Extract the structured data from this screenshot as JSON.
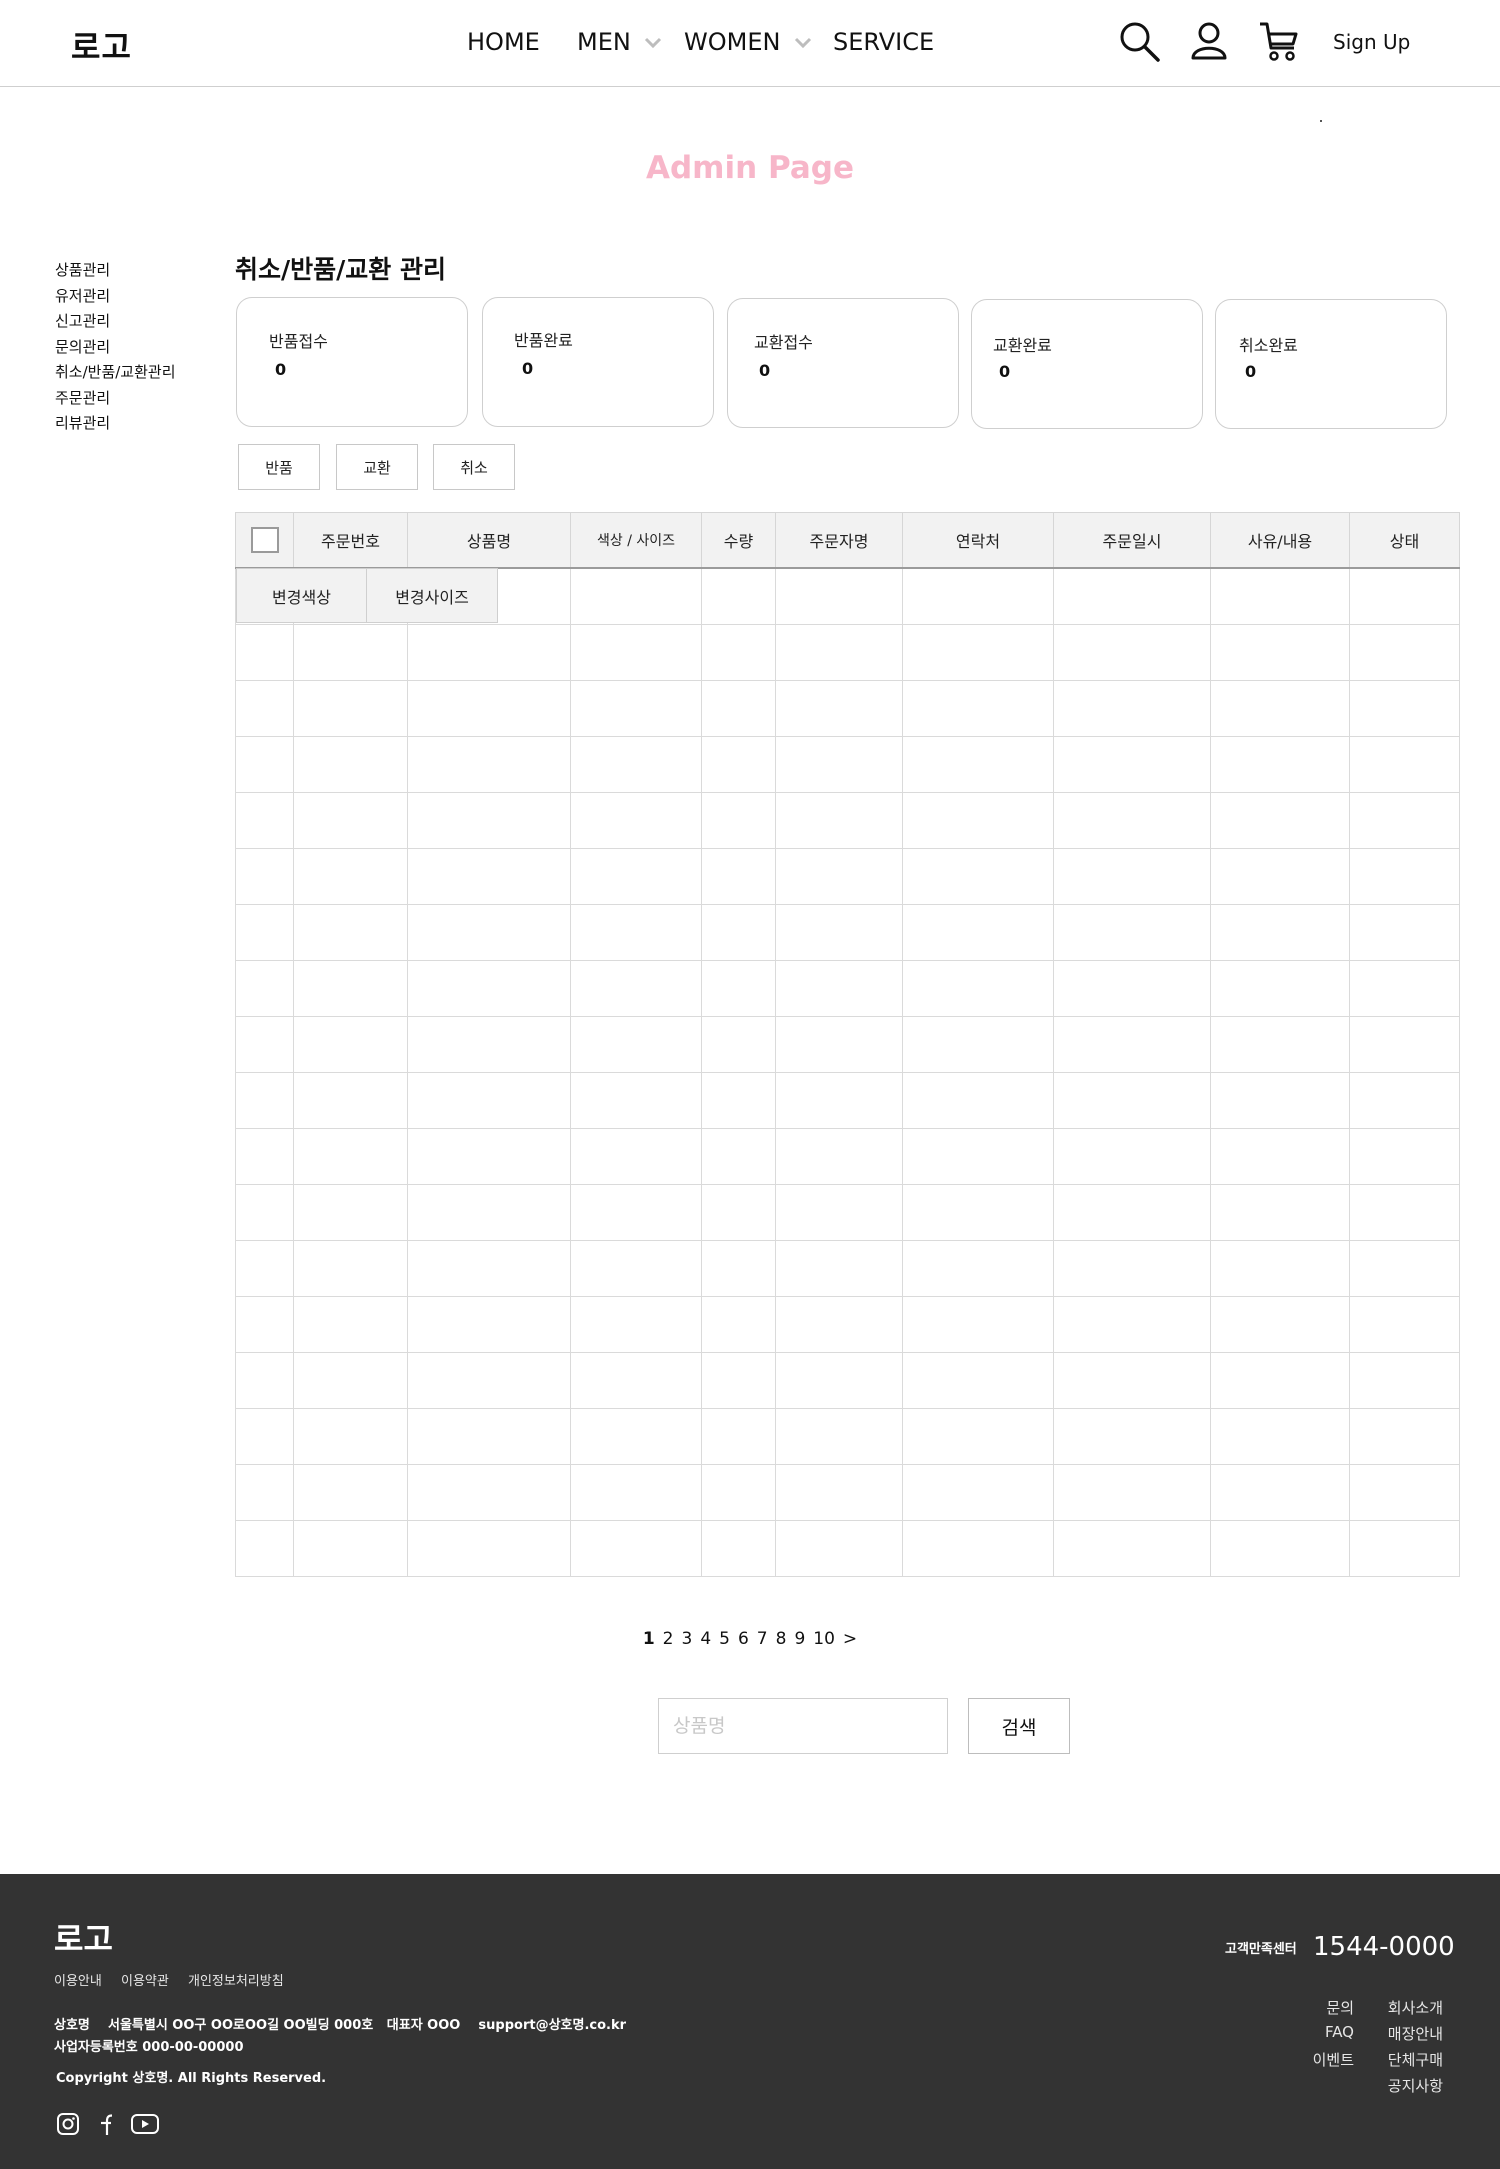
{
  "header": {
    "logo": "로고",
    "nav": [
      "HOME",
      "MEN",
      "WOMEN",
      "SERVICE"
    ],
    "signup": "Sign Up",
    "icons": [
      "search-icon",
      "user-icon",
      "cart-icon"
    ]
  },
  "page_title": "Admin Page",
  "sidebar": {
    "items": [
      "상품관리",
      "유저관리",
      "신고관리",
      "문의관리",
      "취소/반품/교환관리",
      "주문관리",
      "리뷰관리"
    ]
  },
  "section_title": "취소/반품/교환 관리",
  "cards": [
    {
      "label": "반품접수",
      "value": "0"
    },
    {
      "label": "반품완료",
      "value": "0"
    },
    {
      "label": "교환접수",
      "value": "0"
    },
    {
      "label": "교환완료",
      "value": "0"
    },
    {
      "label": "취소완료",
      "value": "0"
    }
  ],
  "filters": [
    "반품",
    "교환",
    "취소"
  ],
  "table": {
    "columns": [
      "",
      "주문번호",
      "상품명",
      "색상 / 사이즈",
      "수량",
      "주문자명",
      "연락처",
      "주문일시",
      "사유/내용",
      "상태"
    ],
    "sub_buttons": [
      "변경색상",
      "변경사이즈"
    ]
  },
  "pagination": {
    "pages": [
      "1",
      "2",
      "3",
      "4",
      "5",
      "6",
      "7",
      "8",
      "9",
      "10"
    ],
    "next": ">",
    "current": "1"
  },
  "search": {
    "placeholder": "상품명",
    "button": "검색"
  },
  "footer": {
    "logo": "로고",
    "links": [
      "이용안내",
      "이용약관",
      "개인정보처리방침"
    ],
    "company_line": "상호명    서울특별시 OO구 OO로OO길 OO빌딩 000호   대표자 OOO    support@상호명.co.kr",
    "registration": "사업자등록번호 000-00-00000",
    "copyright": "Copyright 상호명. All Rights Reserved.",
    "social_icons": [
      "instagram-icon",
      "facebook-icon",
      "youtube-icon"
    ],
    "cs_label": "고객만족센터",
    "cs_phone": "1544-0000",
    "right_links_col1": [
      "문의",
      "FAQ",
      "이벤트"
    ],
    "right_links_col2": [
      "회사소개",
      "매장안내",
      "단체구매",
      "공지사항"
    ]
  }
}
